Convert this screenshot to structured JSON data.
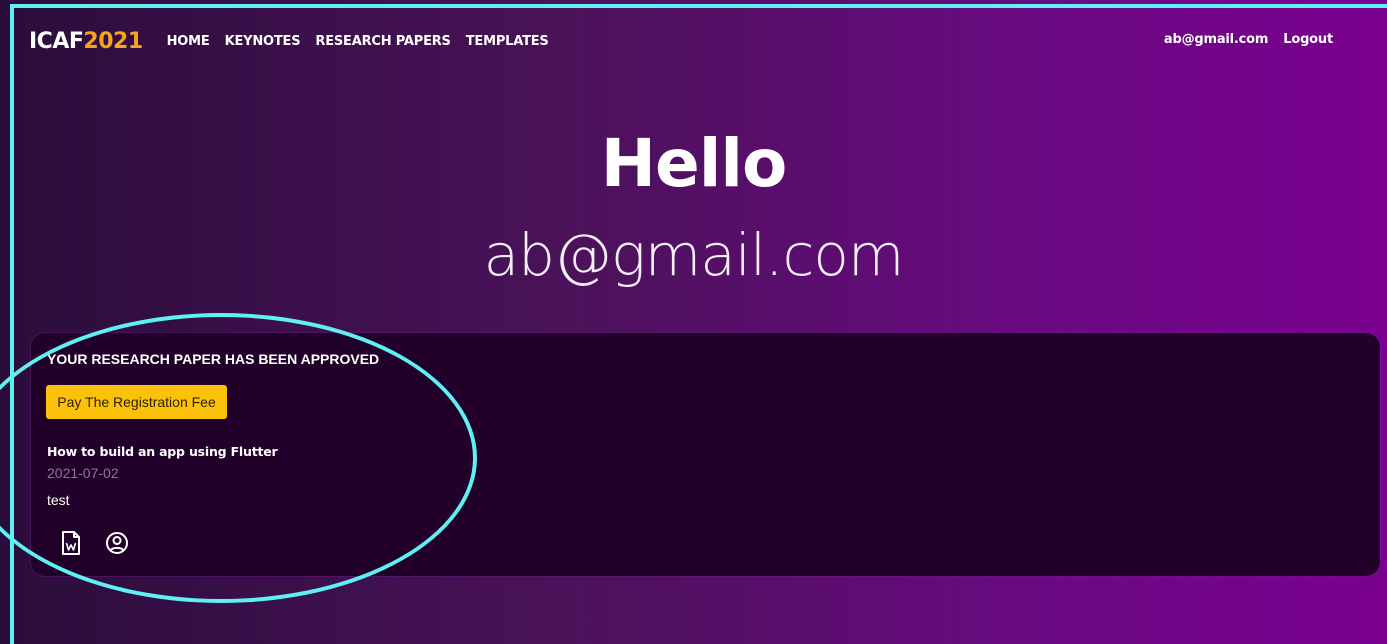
{
  "nav": {
    "brand_part1": "ICAF",
    "brand_part2": "2021",
    "links": [
      "HOME",
      "KEYNOTES",
      "RESEARCH PAPERS",
      "TEMPLATES"
    ],
    "user_email": "ab@gmail.com",
    "logout": "Logout"
  },
  "hero": {
    "greeting": "Hello",
    "email": "ab@gmail.com"
  },
  "card": {
    "status": "YOUR RESEARCH PAPER HAS BEEN APPROVED",
    "pay_button": "Pay The Registration Fee",
    "paper_title": "How to build an app using Flutter",
    "date": "2021-07-02",
    "description": "test",
    "icons": [
      "word-document-icon",
      "user-circle-icon"
    ]
  },
  "colors": {
    "brand_accent": "#f4a51c",
    "button": "#fcc10b",
    "card_bg": "#210029",
    "annotation": "#5ff0f2"
  }
}
